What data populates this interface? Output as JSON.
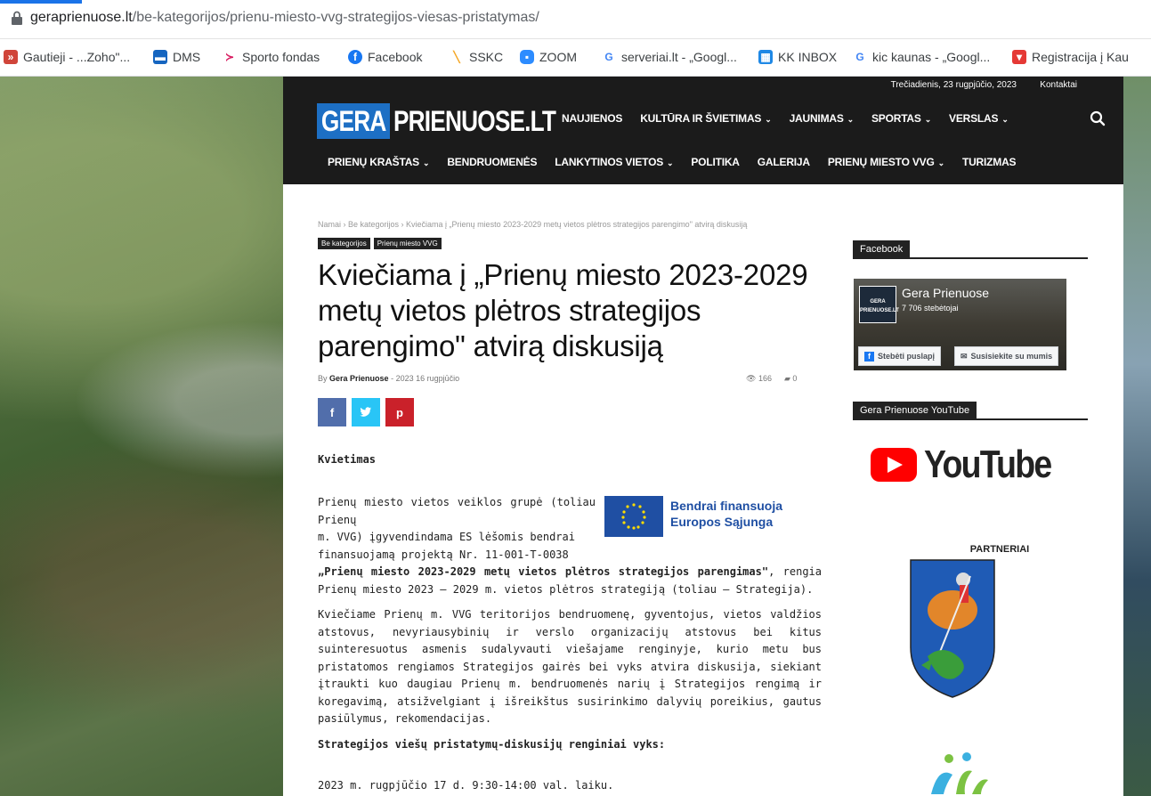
{
  "browser": {
    "url_domain": "geraprienuose.lt",
    "url_path": "/be-kategorijos/prienu-miesto-vvg-strategijos-viesas-pristatymas/",
    "bookmarks": [
      {
        "label": "Gautieji - ...Zoho\"...",
        "icon": "zoho-icon",
        "color": "#d0453a"
      },
      {
        "label": "DMS",
        "icon": "dms-icon",
        "color": "#1565c0"
      },
      {
        "label": "Sporto fondas",
        "icon": "sporto-icon",
        "color": "#d81b60"
      },
      {
        "label": "Facebook",
        "icon": "facebook-icon",
        "color": "#1877f2"
      },
      {
        "label": "SSKC",
        "icon": "sskc-icon",
        "color": "#f5a623"
      },
      {
        "label": "ZOOM",
        "icon": "zoom-icon",
        "color": "#2d8cff"
      },
      {
        "label": "serveriai.lt - „Googl...",
        "icon": "google-icon",
        "color": "#4285f4"
      },
      {
        "label": "KK INBOX",
        "icon": "kk-icon",
        "color": "#1e88e5"
      },
      {
        "label": "kic kaunas - „Googl...",
        "icon": "google-icon",
        "color": "#4285f4"
      },
      {
        "label": "Registracija į Kau",
        "icon": "registracija-icon",
        "color": "#e53935"
      }
    ]
  },
  "site": {
    "topbar_date": "Trečiadienis, 23 rugpjūčio, 2023",
    "topbar_contact": "Kontaktai",
    "logo_left": "GERA",
    "logo_right": "PRIENUOSE.LT",
    "nav_row1": [
      {
        "label": "NAUJIENOS",
        "dropdown": false
      },
      {
        "label": "KULTŪRA IR ŠVIETIMAS",
        "dropdown": true
      },
      {
        "label": "JAUNIMAS",
        "dropdown": true
      },
      {
        "label": "SPORTAS",
        "dropdown": true
      },
      {
        "label": "VERSLAS",
        "dropdown": true
      }
    ],
    "nav_row2": [
      {
        "label": "PRIENŲ KRAŠTAS",
        "dropdown": true
      },
      {
        "label": "BENDRUOMENĖS",
        "dropdown": false
      },
      {
        "label": "LANKYTINOS VIETOS",
        "dropdown": true
      },
      {
        "label": "POLITIKA",
        "dropdown": false
      },
      {
        "label": "GALERIJA",
        "dropdown": false
      },
      {
        "label": "PRIENŲ MIESTO VVG",
        "dropdown": true
      },
      {
        "label": "TURIZMAS",
        "dropdown": false
      }
    ]
  },
  "article": {
    "breadcrumb": "Namai › Be kategorijos › Kviečiama į „Prienų miesto 2023-2029 metų vietos plėtros strategijos parengimo\" atvirą diskusiją",
    "categories": [
      "Be kategorijos",
      "Prienų miesto VVG"
    ],
    "title": "Kviečiama į „Prienų miesto 2023-2029 metų vietos plėtros strategijos parengimo\" atvirą diskusiją",
    "by_label": "By",
    "author": "Gera Prienuose",
    "date": "2023 16 rugpjūčio",
    "views": "166",
    "comments": "0",
    "share_buttons": [
      {
        "label": "f",
        "icon": "facebook-share-icon",
        "color": "#516eab"
      },
      {
        "label": "t",
        "icon": "twitter-share-icon",
        "color": "#29c5f6"
      },
      {
        "label": "p",
        "icon": "pinterest-share-icon",
        "color": "#ca212a"
      }
    ],
    "heading": "Kvietimas",
    "eu_text_line1": "Bendrai finansuoja",
    "eu_text_line2": "Europos Sąjunga",
    "p1_lines": [
      "Prienų miesto vietos veiklos grupė (toliau Prienų",
      "m. VVG) įgyvendindama ES lėšomis bendrai",
      "finansuojamą projektą Nr. 11-001-T-0038"
    ],
    "p1_bold": "„Prienų miesto 2023-2029 metų vietos plėtros strategijos parengimas\"",
    "p1_rest": ", rengia Prienų miesto 2023 – 2029 m. vietos plėtros strategiją (toliau – Strategija).",
    "p2": "Kviečiame Prienų m. VVG teritorijos bendruomenę, gyventojus, vietos valdžios atstovus, nevyriausybinių ir verslo organizacijų atstovus bei kitus suinteresuotus asmenis sudalyvauti viešajame renginyje, kurio metu bus pristatomos rengiamos Strategijos gairės bei vyks atvira diskusija, siekiant įtraukti kuo daugiau Prienų m. bendruomenės narių į Strategijos rengimą ir koregavimą, atsižvelgiant į išreikštus susirinkimo dalyvių poreikius, gautus pasiūlymus, rekomendacijas.",
    "h2": "Strategijos viešų pristatymų-diskusijų renginiai vyks:",
    "p3": "2023 m. rugpjūčio 17 d. 9:30-14:00 val. laiku."
  },
  "sidebar": {
    "facebook_heading": "Facebook",
    "fb_page_name": "Gera Prienuose",
    "fb_followers": "7 706 stebėtojai",
    "fb_thumb_text": "GERA PRIENUOSE.LT",
    "fb_follow_label": "Stebėti puslapį",
    "fb_contact_label": "Susisiekite su mumis",
    "youtube_heading": "Gera Prienuose YouTube",
    "youtube_logo_text": "YouTube",
    "partners_label": "PARTNERIAI"
  }
}
